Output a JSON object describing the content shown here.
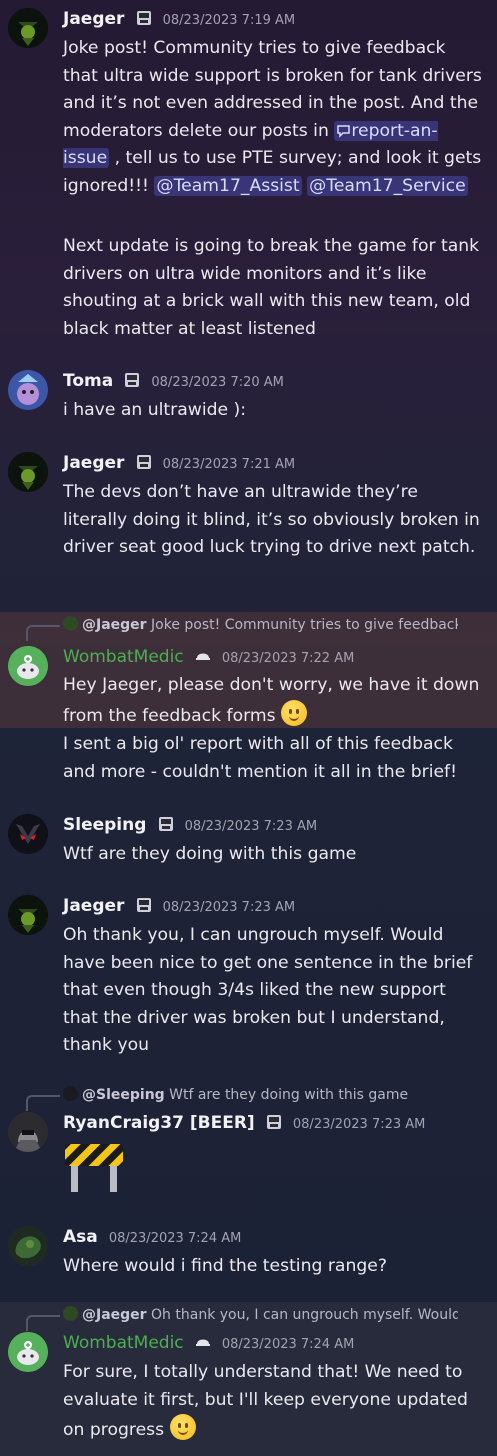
{
  "messages": [
    {
      "author": "Jaeger",
      "timestamp": "08/23/2023 7:19 AM",
      "p1_a": "Joke post! Community tries to give feedback that ultra wide support is broken for tank drivers and it’s not even addressed in the post. And the moderators delete our posts in ",
      "channel_mention": "report-an-issue",
      "p1_b": " , tell us to use PTE survey; and look it gets ignored!!! ",
      "mention1": "@Team17_Assist",
      "mention2": "@Team17_Service",
      "p2": "Next update is going to break the game for tank drivers on ultra wide monitors and it’s like shouting at a brick wall with this new team, old black matter at least listened"
    },
    {
      "author": "Toma",
      "timestamp": "08/23/2023 7:20 AM",
      "text": "i have an ultrawide ):"
    },
    {
      "author": "Jaeger",
      "timestamp": "08/23/2023 7:21 AM",
      "text": "The devs don’t have an ultrawide they’re literally doing it blind, it’s so obviously broken in driver seat good luck trying to drive next patch."
    },
    {
      "reply_author": "@Jaeger",
      "reply_text": "Joke post! Community tries to give feedback that ultra wide support is broken",
      "author": "WombatMedic",
      "timestamp": "08/23/2023 7:22 AM",
      "text": "Hey Jaeger, please don't worry, we have it down from the feedback forms",
      "text2": "I sent a big ol' report with all of this feedback and more - couldn't mention it all in the brief!"
    },
    {
      "author": "Sleeping",
      "timestamp": "08/23/2023 7:23 AM",
      "text": "Wtf are they doing with this game"
    },
    {
      "author": "Jaeger",
      "timestamp": "08/23/2023 7:23 AM",
      "text": "Oh thank you, I can ungrouch myself. Would have been nice to get one sentence in the brief that even though 3/4s liked the new support that the driver was broken but I understand, thank you"
    },
    {
      "reply_author": "@Sleeping",
      "reply_text": "Wtf are they doing with this game",
      "author": "RyanCraig37 [BEER]",
      "timestamp": "08/23/2023 7:23 AM"
    },
    {
      "author": "Asa",
      "timestamp": "08/23/2023 7:24 AM",
      "text": "Where would i find the testing range?"
    },
    {
      "reply_author": "@Jaeger",
      "reply_text": "Oh thank you, I can ungrouch myself. Would have been nice to get one sentence",
      "author": "WombatMedic",
      "timestamp": "08/23/2023 7:24 AM",
      "text": "For sure, I totally understand that! We need to evaluate it first, but I'll keep everyone updated on progress"
    }
  ]
}
